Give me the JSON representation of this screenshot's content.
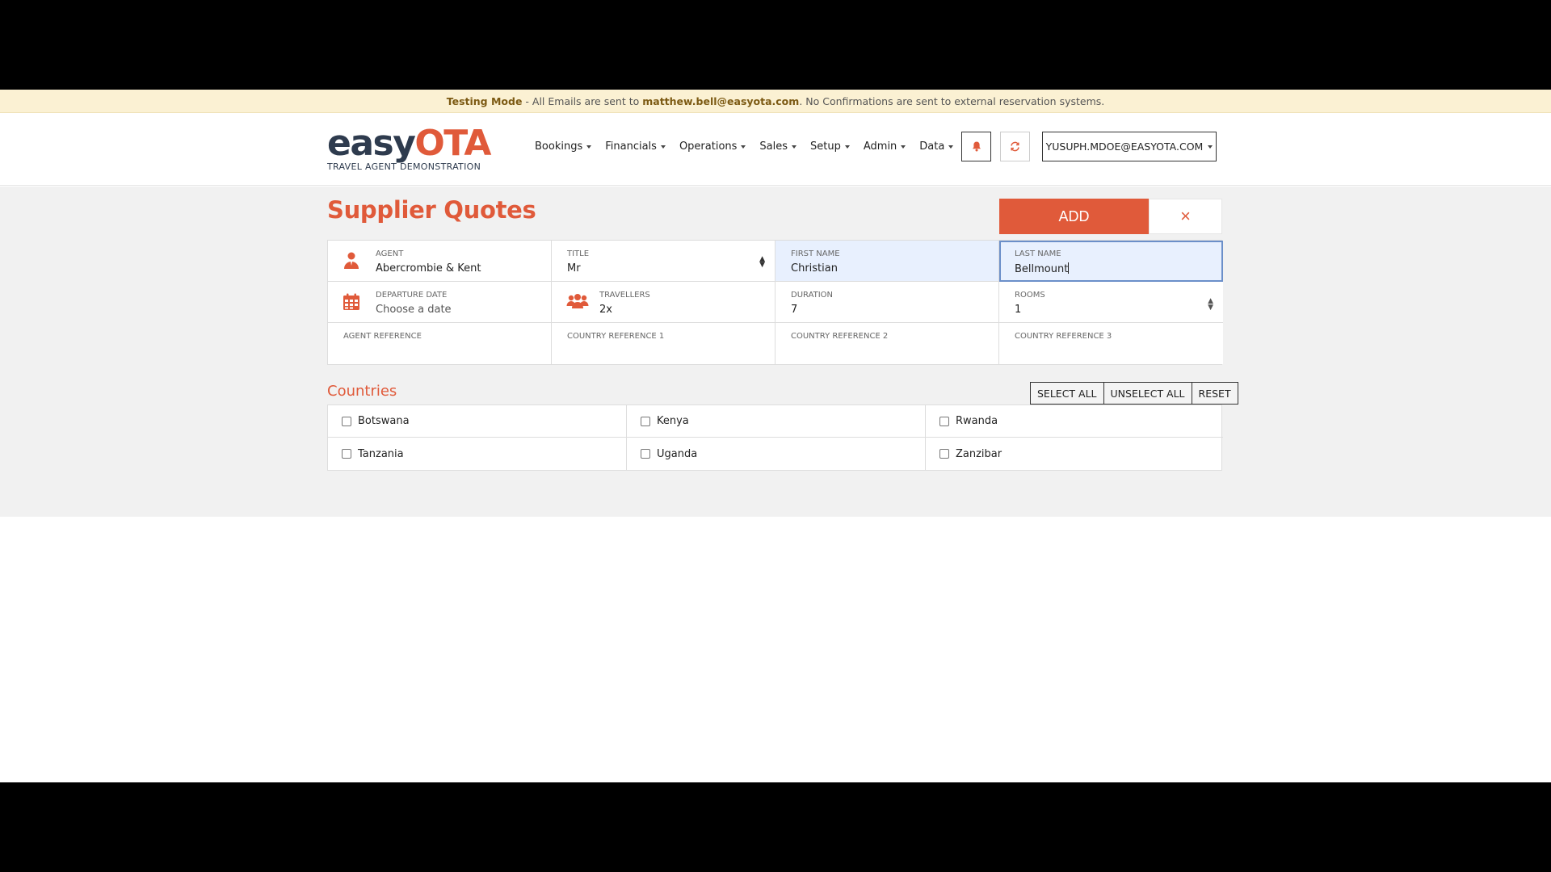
{
  "banner": {
    "mode": "Testing Mode",
    "text1": " - All Emails are sent to ",
    "email": "matthew.bell@easyota.com",
    "text2": ". No Confirmations are sent to external reservation systems."
  },
  "logo": {
    "easy": "easy",
    "ota": "OTA",
    "subtitle": "TRAVEL AGENT DEMONSTRATION"
  },
  "nav": [
    "Bookings",
    "Financials",
    "Operations",
    "Sales",
    "Setup",
    "Admin",
    "Data"
  ],
  "user": {
    "email": "YUSUPH.MDOE@EASYOTA.COM"
  },
  "page": {
    "title": "Supplier Quotes",
    "add_label": "ADD",
    "close_label": "×"
  },
  "form": {
    "agent": {
      "label": "AGENT",
      "value": "Abercrombie & Kent"
    },
    "title": {
      "label": "TITLE",
      "value": "Mr"
    },
    "first_name": {
      "label": "FIRST NAME",
      "value": "Christian"
    },
    "last_name": {
      "label": "LAST NAME",
      "value": "Bellmount"
    },
    "departure_date": {
      "label": "DEPARTURE DATE",
      "placeholder": "Choose a date"
    },
    "travellers": {
      "label": "TRAVELLERS",
      "value": "2x"
    },
    "duration": {
      "label": "DURATION",
      "value": "7"
    },
    "rooms": {
      "label": "ROOMS",
      "value": "1"
    },
    "agent_reference": {
      "label": "AGENT REFERENCE"
    },
    "country_reference_1": {
      "label": "COUNTRY REFERENCE 1"
    },
    "country_reference_2": {
      "label": "COUNTRY REFERENCE 2"
    },
    "country_reference_3": {
      "label": "COUNTRY REFERENCE 3"
    }
  },
  "countries": {
    "title": "Countries",
    "select_all": "SELECT ALL",
    "unselect_all": "UNSELECT ALL",
    "reset": "RESET",
    "items": [
      "Botswana",
      "Kenya",
      "Rwanda",
      "Tanzania",
      "Uganda",
      "Zanzibar"
    ]
  },
  "colors": {
    "accent": "#e05a3a",
    "brand_dark": "#2e3b4e",
    "banner_bg": "#fbf1d3"
  },
  "icons": [
    "person-icon",
    "calendar-icon",
    "group-icon",
    "bell-icon",
    "refresh-icon"
  ]
}
